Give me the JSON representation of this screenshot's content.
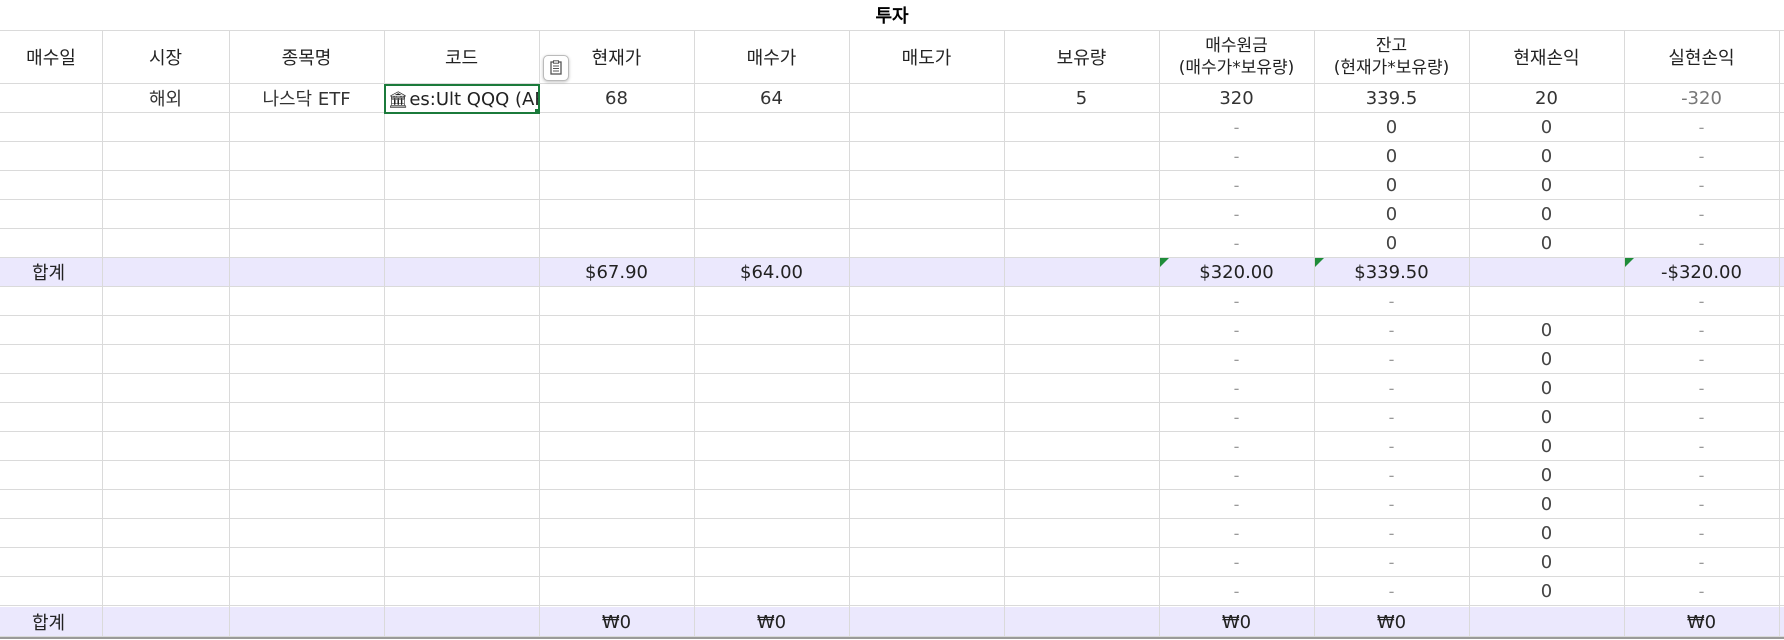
{
  "sheet_title": "투자",
  "headers": {
    "buy_date": "매수일",
    "market": "시장",
    "name": "종목명",
    "code": "코드",
    "current_price": "현재가",
    "buy_price": "매수가",
    "sell_price": "매도가",
    "quantity": "보유량",
    "principal_line1": "매수원금",
    "principal_line2": "(매수가*보유량)",
    "balance_line1": "잔고",
    "balance_line2": "(현재가*보유량)",
    "unrealized": "현재손익",
    "realized": "실현손익"
  },
  "row1": {
    "market": "해외",
    "name": "나스닥 ETF",
    "code_icon": "bank-icon",
    "code": "es:Ult QQQ (ARC",
    "current_price": "68",
    "buy_price": "64",
    "quantity": "5",
    "principal": "320",
    "balance": "339.5",
    "unrealized": "20",
    "realized": "-320"
  },
  "dash": "-",
  "zero": "0",
  "total1": {
    "label": "합계",
    "current_price": "$67.90",
    "buy_price": "$64.00",
    "principal": "$320.00",
    "balance": "$339.50",
    "realized": "-$320.00"
  },
  "total2": {
    "label": "합계",
    "current_price": "₩0",
    "buy_price": "₩0",
    "principal": "₩0",
    "balance": "₩0",
    "realized": "₩0"
  },
  "colors": {
    "total_band": "#ebe8fd",
    "selection": "#1b7a3b",
    "comment_marker": "#1e8c3a"
  },
  "icons": {
    "paste_options": "paste-options-icon"
  }
}
